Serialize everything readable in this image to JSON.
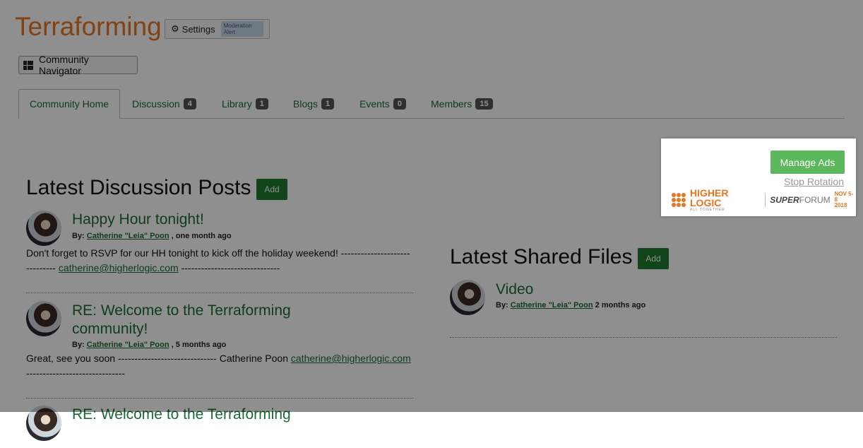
{
  "header": {
    "title": "Terraforming",
    "settings_label": "Settings",
    "moderation_badge": "Moderation Alert",
    "navigator_label": "Community Navigator"
  },
  "tabs": [
    {
      "label": "Community Home",
      "count": null,
      "active": true
    },
    {
      "label": "Discussion",
      "count": "4"
    },
    {
      "label": "Library",
      "count": "1"
    },
    {
      "label": "Blogs",
      "count": "1"
    },
    {
      "label": "Events",
      "count": "0"
    },
    {
      "label": "Members",
      "count": "15"
    }
  ],
  "discussion": {
    "title": "Latest Discussion Posts",
    "add_label": "Add",
    "posts": [
      {
        "title": "Happy Hour tonight!",
        "by_label": "By:",
        "author": "Catherine \"Leia\" Poon",
        "time": ", one month ago",
        "body_before": "Don't forget to RSVP for our HH tonight to kick off the holiday weekend! ------------------------------ ",
        "email": "catherine@higherlogic.com",
        "body_after": " ------------------------------"
      },
      {
        "title_line1": "RE: Welcome to the Terraforming",
        "title_line2": "community!",
        "by_label": "By:",
        "author": "Catherine \"Leia\" Poon",
        "time": ", 5 months ago",
        "body_before": "Great, see you soon ------------------------------ Catherine Poon ",
        "email": "catherine@higherlogic.com",
        "body_after": " ------------------------------"
      },
      {
        "title": "RE: Welcome to the Terraforming"
      }
    ]
  },
  "files": {
    "title": "Latest Shared Files",
    "add_label": "Add",
    "items": [
      {
        "title": "Video",
        "by_label": "By:",
        "author": "Catherine \"Leia\" Poon",
        "time": "2 months ago"
      }
    ]
  },
  "ads": {
    "manage_label": "Manage Ads",
    "stop_label": "Stop Rotation",
    "brand_name": "HIGHER LOGIC",
    "brand_tagline": "ALL TOGETHER",
    "event_super": "SUPER",
    "event_forum": "FORUM",
    "event_date": "NOV 5-8",
    "event_year": "2018"
  },
  "colors": {
    "title_orange": "#e8761f",
    "link_green": "#1a6b35",
    "add_green": "#1e7a2e",
    "manage_green": "#5cb85c",
    "overlay": "rgba(0,0,0,0.44)"
  }
}
